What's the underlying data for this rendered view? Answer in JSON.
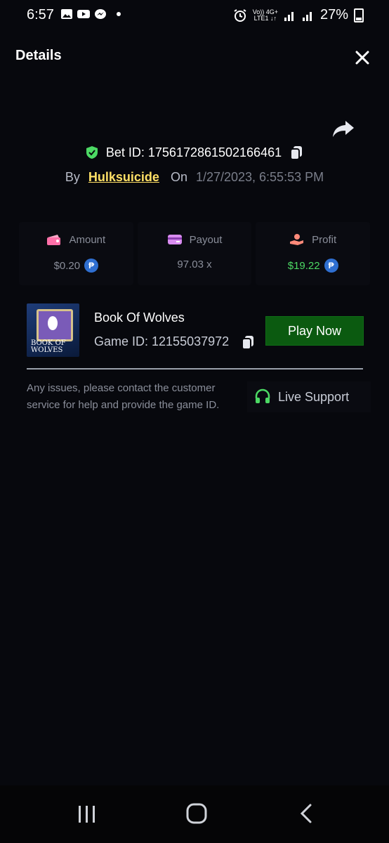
{
  "status_bar": {
    "time": "6:57",
    "network_top": "Vo)) 4G+",
    "network_bottom": "LTE1 ↓↑",
    "battery": "27%"
  },
  "header": {
    "title": "Details"
  },
  "bet": {
    "id_label": "Bet ID: 1756172861502166461",
    "by_label": "By",
    "user": "Hulksuicide",
    "on_label": "On",
    "datetime": "1/27/2023, 6:55:53 PM"
  },
  "stats": {
    "amount": {
      "label": "Amount",
      "value": "$0.20"
    },
    "payout": {
      "label": "Payout",
      "value": "97.03 x"
    },
    "profit": {
      "label": "Profit",
      "value": "$19.22"
    }
  },
  "game": {
    "thumb_text": "BOOK OF WOLVES",
    "name": "Book Of Wolves",
    "id_label": "Game ID: 12155037972",
    "play_label": "Play Now"
  },
  "support": {
    "info": "Any issues, please contact the customer service for help and provide the game ID.",
    "button_label": "Live Support"
  },
  "icons": {
    "coin_symbol": "₱",
    "accent_green": "#4cd964",
    "user_yellow": "#ffe066",
    "play_green": "#0b5a10"
  }
}
